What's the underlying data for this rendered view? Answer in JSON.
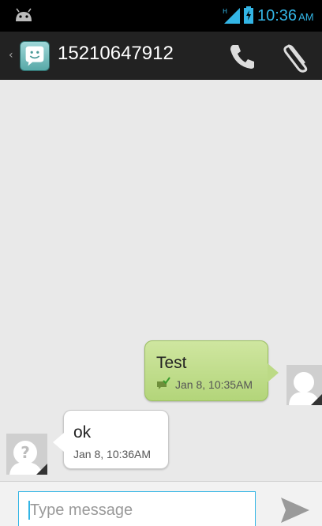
{
  "status_bar": {
    "time": "10:36",
    "ampm": "AM",
    "network_label": "H",
    "accent_color": "#33b5e5",
    "icons": [
      "android-icon",
      "signal-icon",
      "battery-icon"
    ]
  },
  "action_bar": {
    "up_glyph": "‹",
    "title": "15210647912",
    "icons": [
      "contact-avatar-icon",
      "call-icon",
      "attach-icon"
    ]
  },
  "messages": [
    {
      "direction": "outgoing",
      "text": "Test",
      "time": "Jan 8, 10:35AM",
      "status_icon": "delivered-icon"
    },
    {
      "direction": "incoming",
      "text": "ok",
      "time": "Jan 8, 10:36AM"
    }
  ],
  "compose": {
    "placeholder": "Type message",
    "value": "",
    "send_icon": "send-icon"
  },
  "colors": {
    "outgoing_bubble": "#bcda86",
    "incoming_bubble": "#ffffff",
    "background": "#e9e9e9",
    "action_bar": "#222222"
  }
}
